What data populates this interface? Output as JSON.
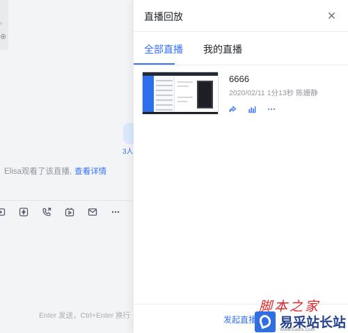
{
  "chat": {
    "notice_text": "Elisa观看了该直播,",
    "notice_link": "查看详情",
    "bubble_count": "3人",
    "input_hint": "Enter 发送，Ctrl+Enter 换行",
    "toolbar_icons": [
      "screenshot-icon",
      "lightning-icon",
      "call-icon",
      "live-icon",
      "mail-icon",
      "more-icon"
    ]
  },
  "panel": {
    "title": "直播回放",
    "tabs": [
      {
        "label": "全部直播",
        "active": true
      },
      {
        "label": "我的直播",
        "active": false
      }
    ],
    "items": [
      {
        "title": "6666",
        "meta": "2020/02/11  1分13秒  陈姗静",
        "actions": [
          "share-icon",
          "stats-icon",
          "more-icon"
        ]
      }
    ],
    "footer_button": "发起直播"
  },
  "watermark": {
    "top": "脚本之家",
    "main": "易采站长站",
    "url": "Www.Easck.Com"
  },
  "colors": {
    "accent": "#3370ff",
    "watermark_red": "#e0262a",
    "watermark_blue": "#2f6fe0"
  }
}
